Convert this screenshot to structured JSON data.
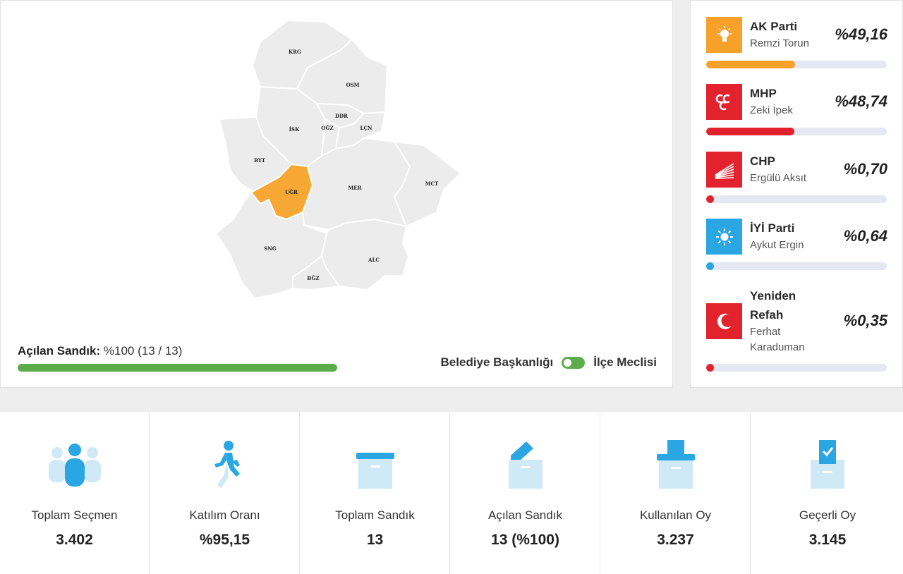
{
  "map": {
    "districts": [
      {
        "id": "KRG",
        "label": "KRG"
      },
      {
        "id": "OSM",
        "label": "OSM"
      },
      {
        "id": "DDR",
        "label": "DDR"
      },
      {
        "id": "İSK",
        "label": "İSK"
      },
      {
        "id": "OĞZ",
        "label": "OĞZ"
      },
      {
        "id": "LÇN",
        "label": "LÇN"
      },
      {
        "id": "BYT",
        "label": "BYT"
      },
      {
        "id": "UĞR",
        "label": "UĞR",
        "active": true
      },
      {
        "id": "MER",
        "label": "MER"
      },
      {
        "id": "MCT",
        "label": "MCT"
      },
      {
        "id": "SNG",
        "label": "SNG"
      },
      {
        "id": "ALC",
        "label": "ALC"
      },
      {
        "id": "BĞZ",
        "label": "BĞZ"
      }
    ],
    "active_color": "#f7a733",
    "default_color": "#ececec"
  },
  "ballot": {
    "label": "Açılan Sandık:",
    "value": "%100 (13 / 13)",
    "progress": 1.0,
    "color": "#5cac4a"
  },
  "toggle": {
    "left_label": "Belediye Başkanlığı",
    "right_label": "İlçe Meclisi",
    "color": "#5cac4a"
  },
  "results": [
    {
      "party": "AK Parti",
      "candidate": "Remzi Torun",
      "pct_text": "%49,16",
      "pct": 49.16,
      "color": "#f7a12b",
      "logo_bg": "#f7a12b",
      "icon": "lightbulb-icon"
    },
    {
      "party": "MHP",
      "candidate": "Zeki İpek",
      "pct_text": "%48,74",
      "pct": 48.74,
      "color": "#e2232e",
      "logo_bg": "#e2232e",
      "icon": "three-crescents-icon"
    },
    {
      "party": "CHP",
      "candidate": "Ergülü Aksıt",
      "pct_text": "%0,70",
      "pct": 0.7,
      "color": "#e2232e",
      "logo_bg": "#e2232e",
      "icon": "six-arrows-icon"
    },
    {
      "party": "İYİ Parti",
      "candidate": "Aykut Ergin",
      "pct_text": "%0,64",
      "pct": 0.64,
      "color": "#2aa6e3",
      "logo_bg": "#2aa6e3",
      "icon": "sun-icon"
    },
    {
      "party_line1": "Yeniden",
      "party_line2": "Refah",
      "candidate_line1": "Ferhat",
      "candidate_line2": "Karaduman",
      "pct_text": "%0,35",
      "pct": 0.35,
      "color": "#e2232e",
      "logo_bg": "#e2232e",
      "icon": "crescent-icon"
    }
  ],
  "stats": [
    {
      "label": "Toplam Seçmen",
      "value": "3.402",
      "icon": "people-icon"
    },
    {
      "label": "Katılım Oranı",
      "value": "%95,15",
      "icon": "walking-person-icon"
    },
    {
      "label": "Toplam Sandık",
      "value": "13",
      "icon": "box-icon"
    },
    {
      "label": "Açılan Sandık",
      "value": "13 (%100)",
      "icon": "open-box-icon"
    },
    {
      "label": "Kullanılan Oy",
      "value": "3.237",
      "icon": "ballot-box-icon"
    },
    {
      "label": "Geçerli Oy",
      "value": "3.145",
      "icon": "checked-ballot-icon"
    }
  ],
  "colors": {
    "icon_blue": "#2aa6e3",
    "icon_light": "#cfe9f7"
  }
}
